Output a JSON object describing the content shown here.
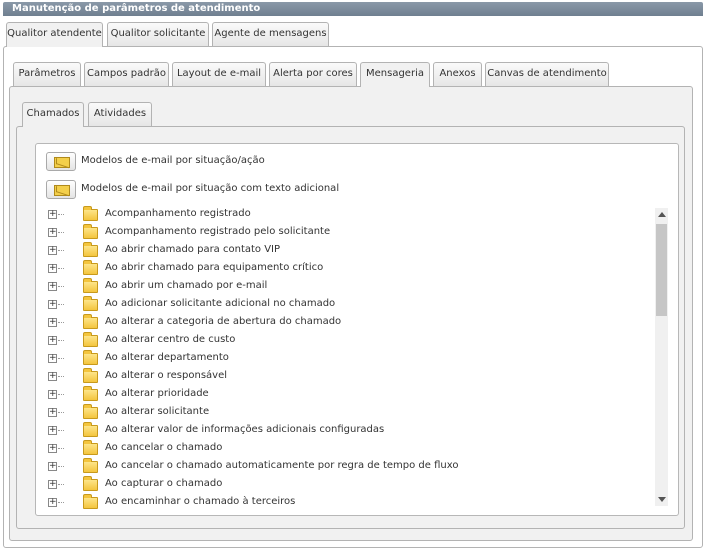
{
  "window": {
    "title": "Manutenção de parâmetros de atendimento"
  },
  "main_tabs": [
    {
      "label": "Qualitor atendente",
      "active": true
    },
    {
      "label": "Qualitor solicitante",
      "active": false
    },
    {
      "label": "Agente de mensagens",
      "active": false
    }
  ],
  "sub_tabs": [
    {
      "label": "Parâmetros",
      "active": false
    },
    {
      "label": "Campos padrão",
      "active": false
    },
    {
      "label": "Layout de e-mail",
      "active": false
    },
    {
      "label": "Alerta por cores",
      "active": false
    },
    {
      "label": "Mensageria",
      "active": true
    },
    {
      "label": "Anexos",
      "active": false
    },
    {
      "label": "Canvas de atendimento",
      "active": false
    }
  ],
  "inner_tabs": [
    {
      "label": "Chamados",
      "active": true
    },
    {
      "label": "Atividades",
      "active": false
    }
  ],
  "email_models": [
    {
      "label": "Modelos de e-mail por situação/ação",
      "icon": "envelope-icon"
    },
    {
      "label": "Modelos de e-mail por situação com texto adicional",
      "icon": "envelope-icon"
    }
  ],
  "tree": {
    "expander_symbol": "+",
    "items": [
      "Acompanhamento registrado",
      "Acompanhamento registrado pelo solicitante",
      "Ao abrir chamado para contato VIP",
      "Ao abrir chamado para equipamento crítico",
      "Ao abrir um chamado por e-mail",
      "Ao adicionar solicitante adicional no chamado",
      "Ao alterar a categoria de abertura do chamado",
      "Ao alterar centro de custo",
      "Ao alterar departamento",
      "Ao alterar o responsável",
      "Ao alterar prioridade",
      "Ao alterar solicitante",
      "Ao alterar valor de informações adicionais configuradas",
      "Ao cancelar o chamado",
      "Ao cancelar o chamado automaticamente por regra de tempo de fluxo",
      "Ao capturar o chamado",
      "Ao encaminhar o chamado à terceiros"
    ]
  },
  "colors": {
    "titlebar": "#7b8b9c",
    "folder": "#f4c53e"
  }
}
